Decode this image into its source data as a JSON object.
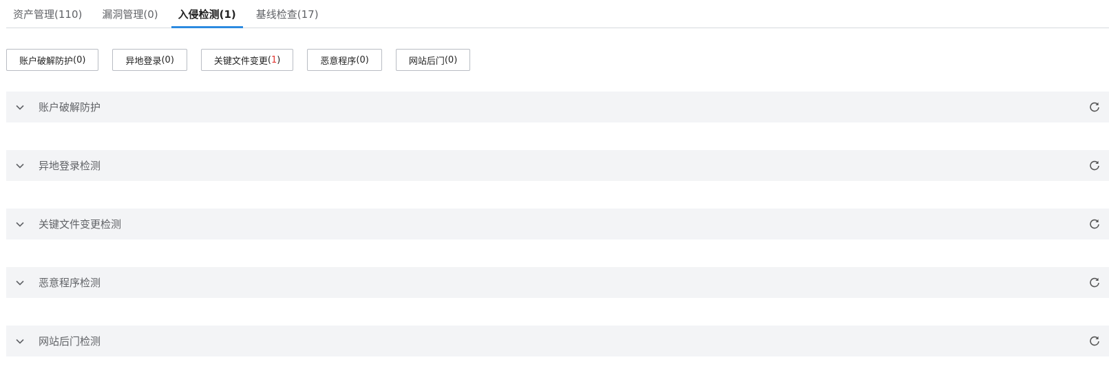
{
  "tabs": [
    {
      "label": "资产管理(110)",
      "active": false
    },
    {
      "label": "漏洞管理(0)",
      "active": false
    },
    {
      "label": "入侵检测(1)",
      "active": true
    },
    {
      "label": "基线检查(17)",
      "active": false
    }
  ],
  "filters": [
    {
      "label": "账户破解防护",
      "open": " (",
      "count": "0",
      "close": ")",
      "highlight": false
    },
    {
      "label": "异地登录",
      "open": " (",
      "count": "0",
      "close": ")",
      "highlight": false
    },
    {
      "label": "关键文件变更",
      "open": " (",
      "count": "1",
      "close": ")",
      "highlight": true
    },
    {
      "label": "恶意程序",
      "open": " (",
      "count": "0",
      "close": ")",
      "highlight": false
    },
    {
      "label": "网站后门",
      "open": " (",
      "count": "0",
      "close": ")",
      "highlight": false
    }
  ],
  "sections": [
    {
      "title": "账户破解防护"
    },
    {
      "title": "异地登录检测"
    },
    {
      "title": "关键文件变更检测"
    },
    {
      "title": "恶意程序检测"
    },
    {
      "title": "网站后门检测"
    }
  ],
  "colors": {
    "accent": "#2b8ae0",
    "highlight_count": "#e0342f",
    "section_bg": "#f3f4f6"
  },
  "icons": {
    "section_toggle": "chevron-down-icon",
    "section_action": "refresh-icon"
  }
}
